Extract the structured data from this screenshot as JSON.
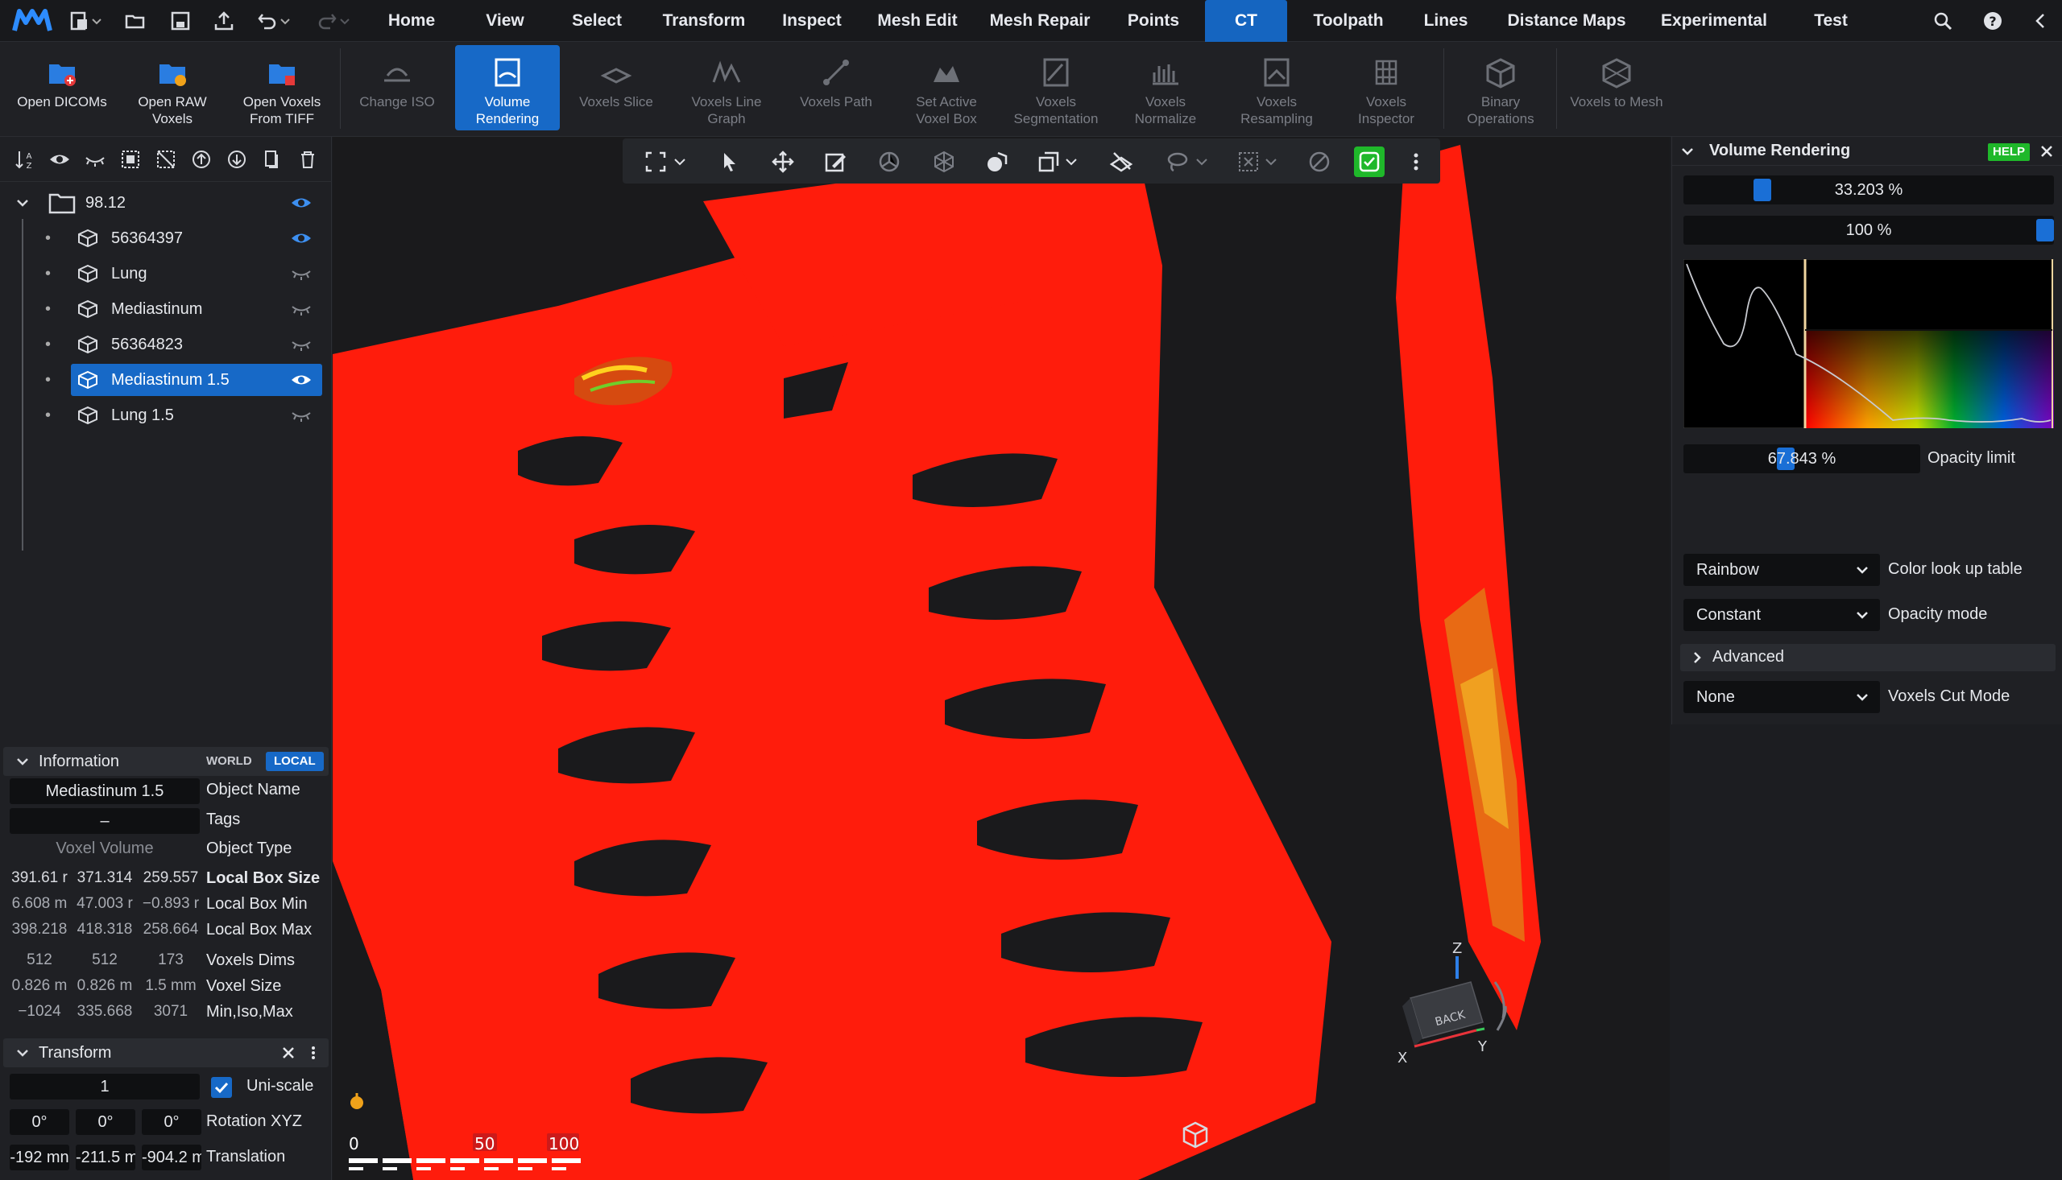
{
  "menu": {
    "items": [
      "Home",
      "View",
      "Select",
      "Transform",
      "Inspect",
      "Mesh Edit",
      "Mesh Repair",
      "Points",
      "CT",
      "Toolpath",
      "Lines",
      "Distance Maps",
      "Experimental",
      "Test"
    ],
    "active": "CT"
  },
  "ribbon": {
    "buttons": [
      {
        "label": "Open DICOMs",
        "icon": "open-dicoms-icon"
      },
      {
        "label": "Open RAW Voxels",
        "icon": "open-raw-voxels-icon"
      },
      {
        "label": "Open Voxels From TIFF",
        "icon": "open-voxels-tiff-icon"
      },
      {
        "label": "Change ISO",
        "icon": "change-iso-icon"
      },
      {
        "label": "Volume Rendering",
        "icon": "volume-rendering-icon"
      },
      {
        "label": "Voxels Slice",
        "icon": "voxels-slice-icon"
      },
      {
        "label": "Voxels Line Graph",
        "icon": "voxels-line-graph-icon"
      },
      {
        "label": "Voxels Path",
        "icon": "voxels-path-icon"
      },
      {
        "label": "Set Active Voxel Box",
        "icon": "set-active-voxel-box-icon"
      },
      {
        "label": "Voxels Segmentation",
        "icon": "voxels-segmentation-icon"
      },
      {
        "label": "Voxels Normalize",
        "icon": "voxels-normalize-icon"
      },
      {
        "label": "Voxels Resampling",
        "icon": "voxels-resampling-icon"
      },
      {
        "label": "Voxels Inspector",
        "icon": "voxels-inspector-icon"
      },
      {
        "label": "Binary Operations",
        "icon": "binary-operations-icon"
      },
      {
        "label": "Voxels to Mesh",
        "icon": "voxels-to-mesh-icon"
      }
    ]
  },
  "tree": {
    "root": "98.12",
    "items": [
      {
        "label": "56364397",
        "visible": true
      },
      {
        "label": "Lung",
        "visible": false
      },
      {
        "label": "Mediastinum",
        "visible": false
      },
      {
        "label": "56364823",
        "visible": false
      },
      {
        "label": "Mediastinum 1.5",
        "visible": true,
        "selected": true
      },
      {
        "label": "Lung 1.5",
        "visible": false
      }
    ]
  },
  "information": {
    "title": "Information",
    "world": "WORLD",
    "local": "LOCAL",
    "object_name": "Mediastinum 1.5",
    "object_name_label": "Object Name",
    "tags": "–",
    "tags_label": "Tags",
    "object_type": "Voxel Volume",
    "object_type_label": "Object Type",
    "rows": [
      {
        "label": "Local Box Size",
        "values": [
          "391.61 r",
          "371.314",
          "259.557"
        ],
        "bold": true
      },
      {
        "label": "Local Box Min",
        "values": [
          "6.608 m",
          "47.003 r",
          "−0.893 r"
        ],
        "bold": false
      },
      {
        "label": "Local Box Max",
        "values": [
          "398.218",
          "418.318",
          "258.664"
        ],
        "bold": false
      },
      {
        "label": "Voxels Dims",
        "values": [
          "512",
          "512",
          "173"
        ],
        "bold": false
      },
      {
        "label": "Voxel Size",
        "values": [
          "0.826 m",
          "0.826 m",
          "1.5 mm"
        ],
        "bold": false
      },
      {
        "label": "Min,Iso,Max",
        "values": [
          "−1024",
          "335.668",
          "3071"
        ],
        "bold": false
      }
    ]
  },
  "transform": {
    "title": "Transform",
    "scale": "1",
    "uniscale_label": "Uni-scale",
    "rotation": [
      "0°",
      "0°",
      "0°"
    ],
    "rotation_label": "Rotation XYZ",
    "translation": [
      "-192 mn",
      "-211.5 m",
      "-904.2 m"
    ],
    "translation_label": "Translation"
  },
  "viewport": {
    "scale_ticks": [
      "0",
      "50",
      "100"
    ],
    "axes": {
      "z": "Z",
      "x": "X",
      "y": "Y",
      "cube_face": "BACK"
    }
  },
  "volume_rendering": {
    "title": "Volume Rendering",
    "help": "HELP",
    "slider1": "33.203 %",
    "slider1_value": 0.33203,
    "slider2": "100 %",
    "slider2_value": 1.0,
    "opacity_limit": "67.843 %",
    "opacity_limit_value": 0.67843,
    "opacity_limit_label": "Opacity limit",
    "color_lut": "Rainbow",
    "color_lut_label": "Color look up table",
    "opacity_mode": "Constant",
    "opacity_mode_label": "Opacity mode",
    "advanced": "Advanced",
    "cut_mode": "None",
    "cut_mode_label": "Voxels Cut Mode"
  },
  "colors": {
    "accent": "#1769c7",
    "active_green": "#1fb82a",
    "render_red": "#ff1a0a"
  }
}
